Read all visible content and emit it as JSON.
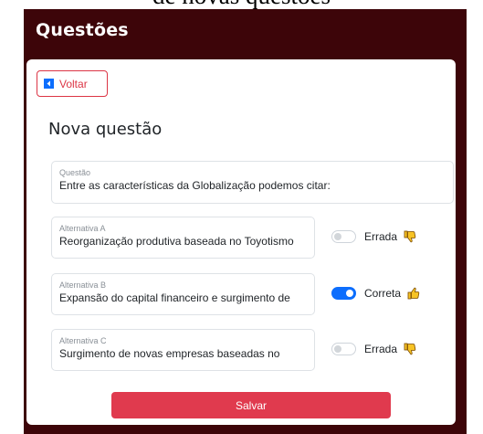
{
  "caption": "de novas questões",
  "app": {
    "title": "Questões"
  },
  "back_button": {
    "label": "Voltar"
  },
  "form": {
    "title": "Nova questão",
    "question": {
      "label": "Questão",
      "value": "Entre as características da Globalização podemos citar:"
    },
    "alternatives": [
      {
        "label": "Alternativa A",
        "value": "Reorganização produtiva baseada no Toyotismo",
        "correct": false,
        "status": "Errada",
        "status_icon": "thumbs-down-icon"
      },
      {
        "label": "Alternativa B",
        "value": "Expansão do capital financeiro e surgimento de",
        "correct": true,
        "status": "Correta",
        "status_icon": "thumbs-up-icon"
      },
      {
        "label": "Alternativa C",
        "value": "Surgimento de novas empresas baseadas no",
        "correct": false,
        "status": "Errada",
        "status_icon": "thumbs-down-icon"
      }
    ],
    "save_label": "Salvar"
  },
  "colors": {
    "frame_bg": "#3d0509",
    "danger": "#dc3545",
    "primary": "#0d6efd",
    "save_bg": "#e03a4e",
    "thumb_yellow": "#f7c325"
  }
}
